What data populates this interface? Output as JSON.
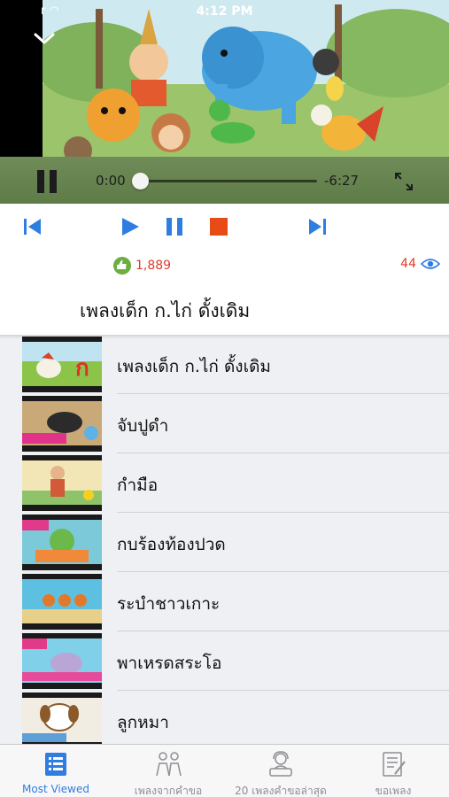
{
  "status_bar": {
    "time": "4:12 PM",
    "carrier": "r"
  },
  "player": {
    "elapsed": "0:00",
    "remaining": "-6:27",
    "progress": 0.0
  },
  "stats": {
    "likes": "1,889",
    "views": "44"
  },
  "now_playing": {
    "title": "เพลงเด็ก ก.ไก่ ดั้งเดิม"
  },
  "playlist": [
    {
      "title": "เพลงเด็ก ก.ไก่ ดั้งเดิม"
    },
    {
      "title": "จับปูดำ"
    },
    {
      "title": "กำมือ"
    },
    {
      "title": "กบร้องท้องปวด"
    },
    {
      "title": "ระบำชาวเกาะ"
    },
    {
      "title": "พาเหรดสระโอ"
    },
    {
      "title": "ลูกหมา"
    }
  ],
  "tabs": [
    {
      "label": "Most Viewed",
      "icon": "list-icon",
      "active": true
    },
    {
      "label": "เพลงจากคำขอ",
      "icon": "request-songs-icon",
      "active": false
    },
    {
      "label": "20 เพลงคำขอล่าสุด",
      "icon": "latest-requests-icon",
      "active": false
    },
    {
      "label": "ขอเพลง",
      "icon": "request-form-icon",
      "active": false
    }
  ],
  "colors": {
    "accent": "#2f7de1",
    "count_red": "#e23a2a",
    "stop_orange": "#e84b16",
    "like_green": "#6dae3f"
  }
}
